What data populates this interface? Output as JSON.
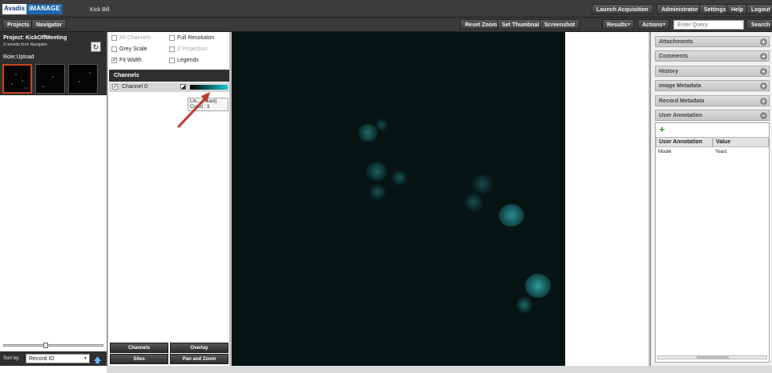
{
  "app": {
    "logo_left": "Avadis",
    "logo_right": "iMANAGE",
    "user": "Kick Bill"
  },
  "topbar": {
    "launch": "Launch Acquisition",
    "admin": "Administrator",
    "settings": "Settings",
    "help": "Help",
    "logout": "Logout"
  },
  "subbar": {
    "projects": "Projects",
    "navigator": "Navigator",
    "reset_zoom": "Reset Zoom",
    "set_thumbnail": "Set Thumbnail",
    "screenshot": "Screenshot",
    "results": "Results",
    "actions": "Actions",
    "search_placeholder": "Enter Query",
    "search": "Search"
  },
  "project": {
    "title": "Project: KickOffMeeting",
    "subtitle": "3 records from Navigator",
    "role": "Role:Upload",
    "refresh_icon": "refresh-icon"
  },
  "sort": {
    "label": "Sort by:",
    "value": "Record ID"
  },
  "options": {
    "all_channels": "All Channels",
    "full_resolution": "Full Resolution",
    "grey_scale": "Grey Scale",
    "z_projection": "Z Projection",
    "fit_width": "Fit Width",
    "legends": "Legends"
  },
  "channels": {
    "heading": "Channels",
    "items": [
      {
        "name": "Channel 0",
        "checked": true,
        "color": "#16c8cf"
      }
    ]
  },
  "tooltip": {
    "line1": "Lin...  (Yeast)",
    "line2": "Count : 3"
  },
  "bottom_buttons": {
    "channels": "Channels",
    "overlay": "Overlay",
    "sites": "Sites",
    "pan_zoom": "Pan and Zoom"
  },
  "right": {
    "sections": [
      "Attachments",
      "Comments",
      "History",
      "Image Metadata",
      "Record Metadata",
      "User Annotation"
    ],
    "table": {
      "headers": [
        "User Annotation",
        "Value"
      ],
      "rows": [
        {
          "key": "Model",
          "value": "Yeast"
        }
      ]
    }
  },
  "colors": {
    "accent": "#c8441f",
    "channel": "#16c8cf",
    "viewer_bg": "#061414"
  }
}
